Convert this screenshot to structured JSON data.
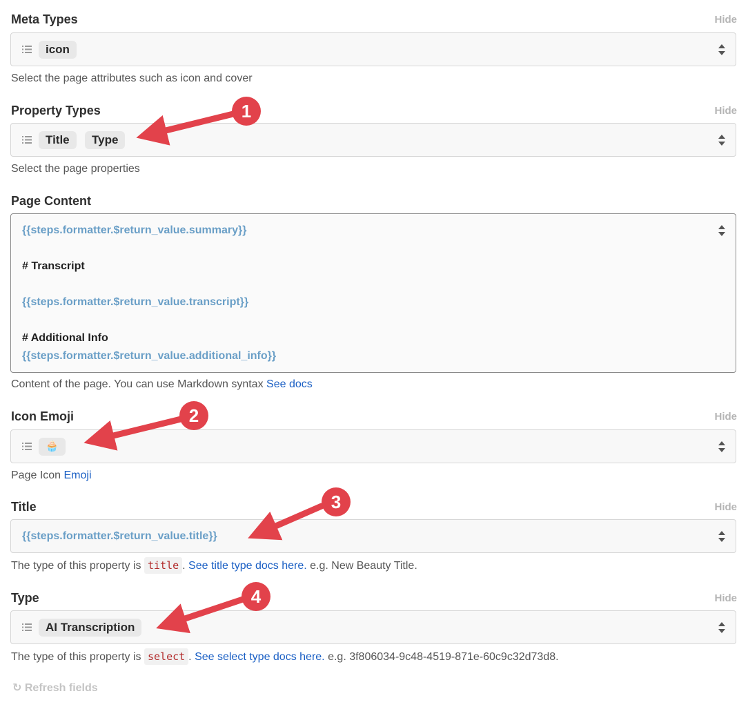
{
  "hide_label": "Hide",
  "meta_types": {
    "label": "Meta Types",
    "chips": [
      "icon"
    ],
    "help": "Select the page attributes such as icon and cover"
  },
  "property_types": {
    "label": "Property Types",
    "chips": [
      "Title",
      "Type"
    ],
    "help": "Select the page properties"
  },
  "page_content": {
    "label": "Page Content",
    "lines": [
      "{{steps.formatter.$return_value.summary}}",
      "# Transcript",
      "{{steps.formatter.$return_value.transcript}}",
      "# Additional Info",
      "{{steps.formatter.$return_value.additional_info}}"
    ],
    "help_text": "Content of the page. You can use Markdown syntax ",
    "help_link": "See docs"
  },
  "icon_emoji": {
    "label": "Icon Emoji",
    "value": "🧁",
    "help_text": "Page Icon ",
    "help_link": "Emoji"
  },
  "title": {
    "label": "Title",
    "value": "{{steps.formatter.$return_value.title}}",
    "help_prefix": "The type of this property is ",
    "help_code": "title",
    "help_link": "See title type docs here.",
    "help_suffix": " e.g. New Beauty Title."
  },
  "type": {
    "label": "Type",
    "value": "AI Transcription",
    "help_prefix": "The type of this property is ",
    "help_code": "select",
    "help_link": "See select type docs here.",
    "help_suffix": " e.g. 3f806034-9c48-4519-871e-60c9c32d73d8."
  },
  "refresh_label": "Refresh fields",
  "annotations": [
    "1",
    "2",
    "3",
    "4"
  ],
  "colors": {
    "annotation_red": "#e2424b",
    "link_blue": "#1a5fc4",
    "template_blue": "#6a9fc7",
    "code_red": "#b22a2a"
  }
}
